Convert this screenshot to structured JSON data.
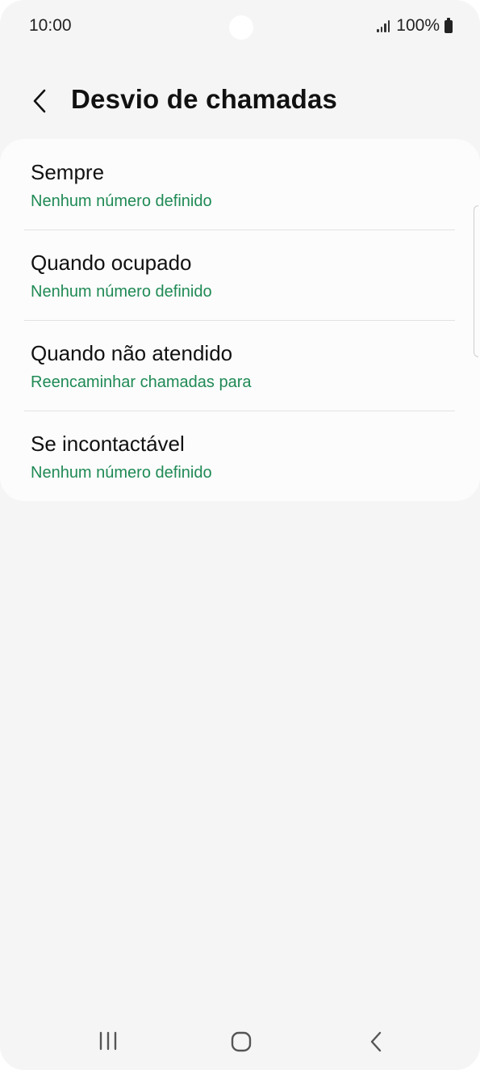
{
  "status_bar": {
    "time": "10:00",
    "battery": "100%",
    "icons": [
      "camera-hole",
      "signal-icon",
      "battery-icon"
    ]
  },
  "header": {
    "back_icon": "back-arrow-icon",
    "title": "Desvio de chamadas"
  },
  "list": {
    "items": [
      {
        "title": "Sempre",
        "subtitle": "Nenhum número definido"
      },
      {
        "title": "Quando ocupado",
        "subtitle": "Nenhum número definido"
      },
      {
        "title": "Quando não atendido",
        "subtitle": "Reencaminhar chamadas para"
      },
      {
        "title": "Se incontactável",
        "subtitle": "Nenhum número definido"
      }
    ]
  },
  "nav_bar": {
    "icons": [
      "recents-icon",
      "home-icon",
      "back-icon"
    ]
  },
  "colors": {
    "background": "#f5f5f5",
    "card": "#fcfcfc",
    "accent_green": "#1f8a55",
    "text": "#111111"
  }
}
